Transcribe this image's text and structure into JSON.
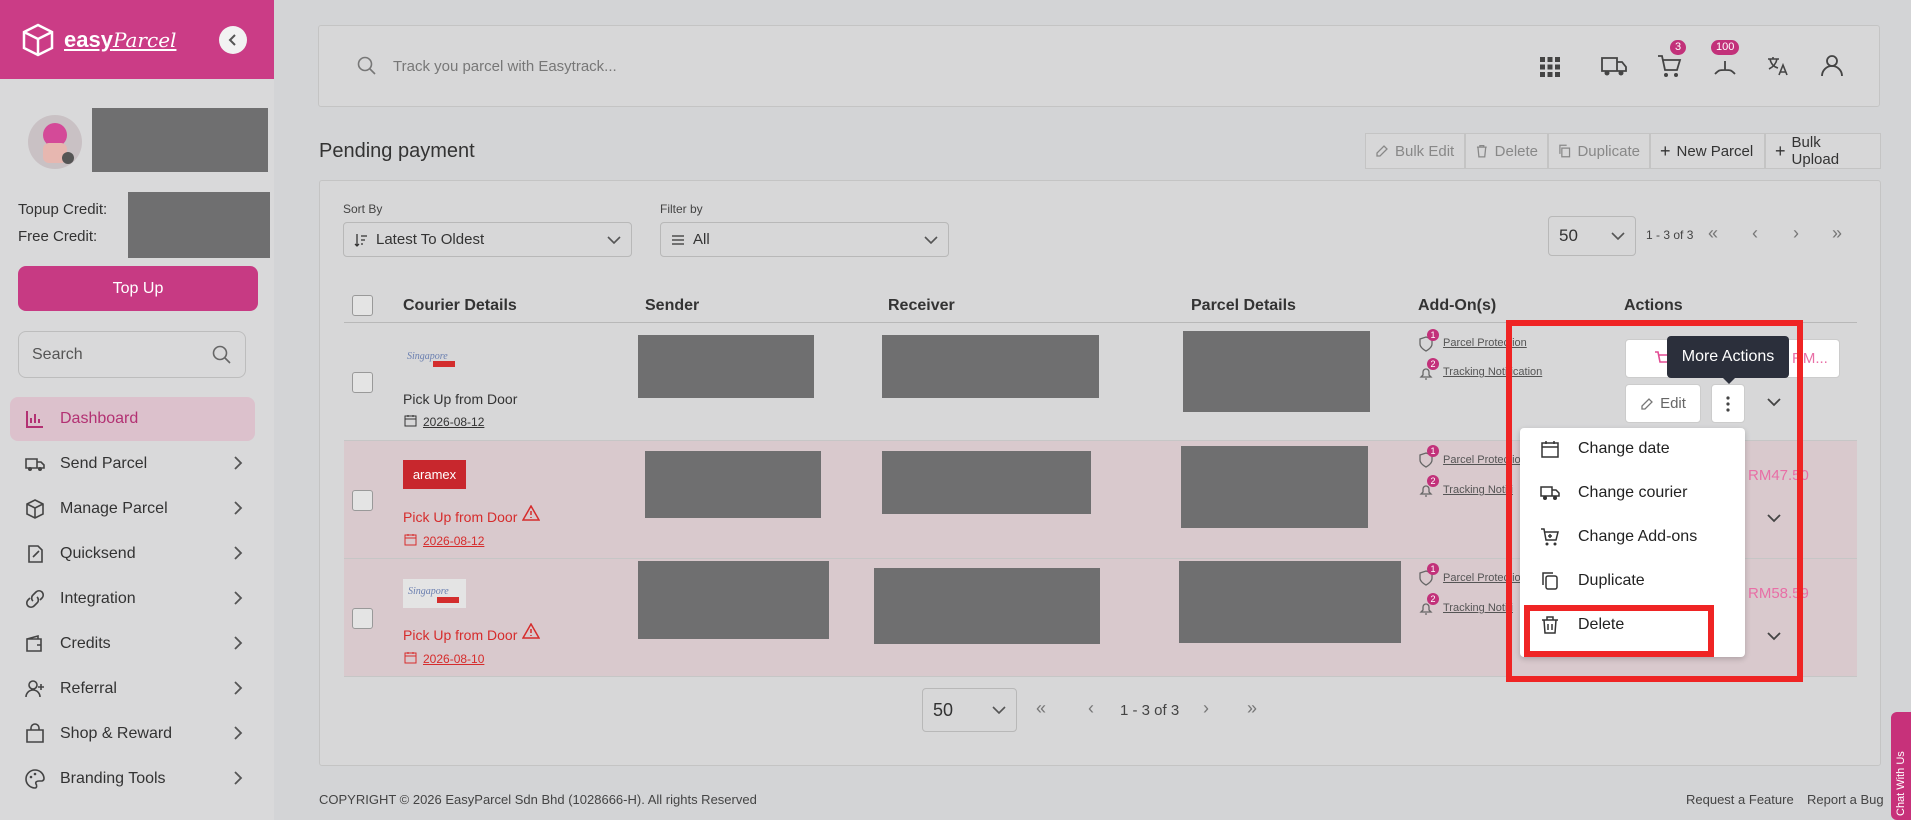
{
  "sidebar": {
    "brand": {
      "name": "easy",
      "script": "Parcel"
    },
    "topup_label": "Topup Credit:",
    "free_label": "Free Credit:",
    "topup_button": "Top Up",
    "search_placeholder": "Search",
    "items": [
      {
        "label": "Dashboard",
        "icon": "dashboard-icon"
      },
      {
        "label": "Send Parcel",
        "icon": "truck-icon"
      },
      {
        "label": "Manage Parcel",
        "icon": "box-icon"
      },
      {
        "label": "Quicksend",
        "icon": "quicksend-icon"
      },
      {
        "label": "Integration",
        "icon": "link-icon"
      },
      {
        "label": "Credits",
        "icon": "wallet-icon"
      },
      {
        "label": "Referral",
        "icon": "user-plus-icon"
      },
      {
        "label": "Shop & Reward",
        "icon": "shopping-bag-icon"
      },
      {
        "label": "Branding Tools",
        "icon": "palette-icon"
      }
    ]
  },
  "topbar": {
    "search_placeholder": "Track you parcel with Easytrack...",
    "cart_count": "3",
    "notif_count": "100"
  },
  "page": {
    "title": "Pending payment"
  },
  "toolbar": {
    "bulk_edit": "Bulk Edit",
    "delete": "Delete",
    "duplicate": "Duplicate",
    "new_parcel": "New Parcel",
    "bulk_upload": "Bulk Upload"
  },
  "filters": {
    "sort_label": "Sort By",
    "sort_value": "Latest To Oldest",
    "filter_label": "Filter by",
    "filter_value": "All",
    "page_size": "50",
    "range": "1 - 3 of 3"
  },
  "table": {
    "headers": [
      "Courier Details",
      "Sender",
      "Receiver",
      "Parcel Details",
      "Add-On(s)",
      "Actions"
    ],
    "rows": [
      {
        "courier": "Singapore Post",
        "pickup": "Pick Up from Door",
        "date": "2026-08-12",
        "warn": false,
        "addons": [
          "Parcel Protection",
          "Tracking Notification"
        ],
        "price": "RM..."
      },
      {
        "courier": "aramex",
        "pickup": "Pick Up from Door",
        "date": "2026-08-12",
        "warn": true,
        "addons": [
          "Parcel Protectio",
          "Tracking Notifi"
        ],
        "price": "RM47.50"
      },
      {
        "courier": "Singapore Post",
        "pickup": "Pick Up from Door",
        "date": "2026-08-10",
        "warn": true,
        "addons": [
          "Parcel Protectio",
          "Tracking Notifi"
        ],
        "price": "RM58.59"
      }
    ],
    "edit_label": "Edit"
  },
  "tooltip": "More Actions",
  "menu": [
    "Change date",
    "Change courier",
    "Change Add-ons",
    "Duplicate",
    "Delete"
  ],
  "bottom_pager": {
    "page_size": "50",
    "range": "1 - 3 of 3"
  },
  "footer": {
    "copyright": "COPYRIGHT © 2026 EasyParcel Sdn Bhd (1028666-H). All rights Reserved",
    "request": "Request a Feature",
    "bug": "Report a Bug"
  },
  "chat": "Chat With Us"
}
